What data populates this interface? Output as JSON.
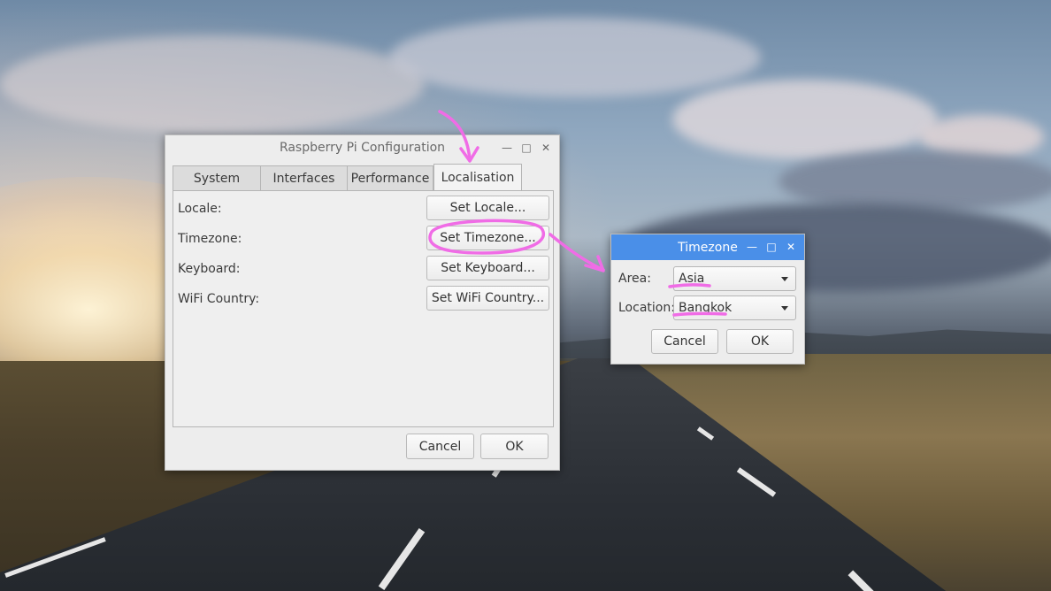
{
  "config_window": {
    "title": "Raspberry Pi Configuration",
    "tabs": [
      {
        "label": "System"
      },
      {
        "label": "Interfaces"
      },
      {
        "label": "Performance"
      },
      {
        "label": "Localisation",
        "active": true
      }
    ],
    "rows": [
      {
        "label": "Locale:",
        "button": "Set Locale..."
      },
      {
        "label": "Timezone:",
        "button": "Set Timezone..."
      },
      {
        "label": "Keyboard:",
        "button": "Set Keyboard..."
      },
      {
        "label": "WiFi Country:",
        "button": "Set WiFi Country..."
      }
    ],
    "cancel_label": "Cancel",
    "ok_label": "OK"
  },
  "timezone_dialog": {
    "title": "Timezone",
    "area_label": "Area:",
    "area_value": "Asia",
    "location_label": "Location:",
    "location_value": "Bangkok",
    "cancel_label": "Cancel",
    "ok_label": "OK",
    "titlebar_color": "#4a8fe8"
  },
  "annotation_color": "#f06ce6",
  "icons": {
    "minimize": "minimize-icon",
    "maximize": "maximize-icon",
    "close": "close-icon",
    "dropdown": "chevron-down-icon"
  }
}
